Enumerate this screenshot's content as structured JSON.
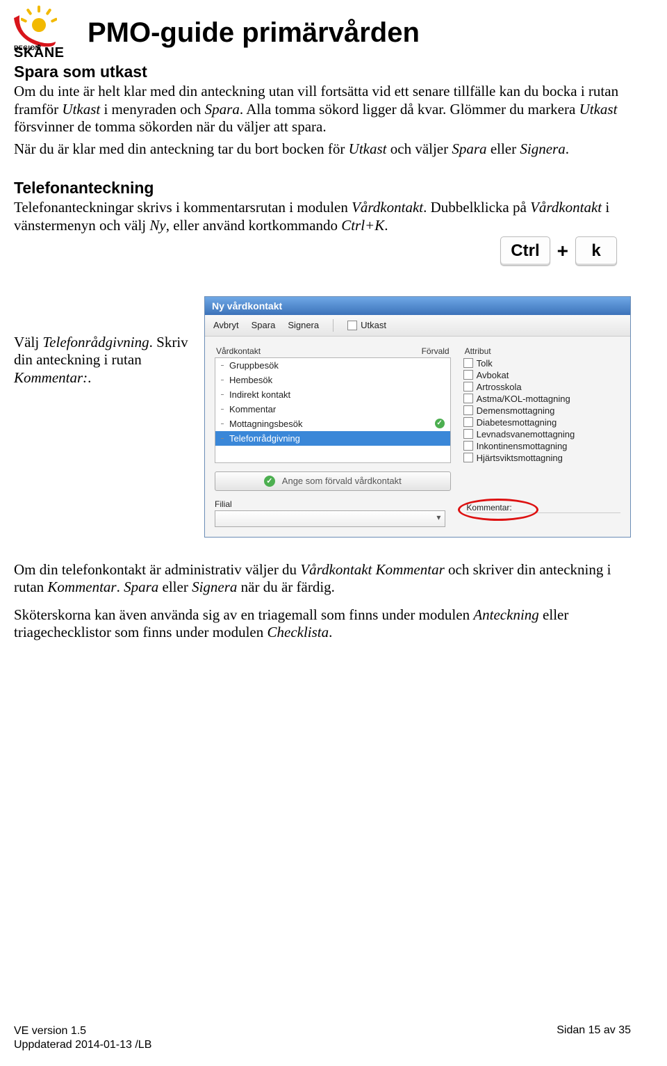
{
  "logo": {
    "region": "REGION",
    "skane": "SKÅNE"
  },
  "doc_title": "PMO-guide primärvården",
  "section1": {
    "heading": "Spara som utkast",
    "para1_a": "Om du inte är helt klar med din anteckning utan vill fortsätta vid ett senare tillfälle kan du bocka i rutan framför ",
    "para1_b": "Utkast",
    "para1_c": " i menyraden och ",
    "para1_d": "Spara",
    "para1_e": ". Alla tomma sökord ligger då kvar. Glömmer du markera ",
    "para1_f": "Utkast",
    "para1_g": " försvinner de tomma sökorden när du väljer att spara.",
    "para2_a": "När du är klar med din anteckning tar du bort bocken för ",
    "para2_b": "Utkast",
    "para2_c": " och väljer ",
    "para2_d": "Spara",
    "para2_e": " eller ",
    "para2_f": "Signera",
    "para2_g": "."
  },
  "section2": {
    "heading": "Telefonanteckning",
    "para_a": "Telefonanteckningar skrivs i kommentarsrutan i modulen ",
    "para_b": "Vårdkontakt",
    "para_c": ". Dubbelklicka på ",
    "para_d": "Vårdkontakt",
    "para_e": " i vänstermenyn och välj ",
    "para_f": "Ny",
    "para_g": ", eller använd kortkommando ",
    "para_h": "Ctrl+K",
    "para_i": "."
  },
  "keys": {
    "ctrl": "Ctrl",
    "plus": "+",
    "k": "k"
  },
  "fig_caption": {
    "a": "Välj ",
    "b": "Telefonrådgivning",
    "c": ". Skriv din anteckning i rutan ",
    "d": "Kommentar:",
    "e": "."
  },
  "dialog": {
    "title": "Ny vårdkontakt",
    "toolbar": {
      "avbryt": "Avbryt",
      "spara": "Spara",
      "signera": "Signera",
      "utkast": "Utkast"
    },
    "col_left_head": "Vårdkontakt",
    "col_left_head2": "Förvald",
    "col_right_head": "Attribut",
    "list": [
      "Gruppbesök",
      "Hembesök",
      "Indirekt kontakt",
      "Kommentar",
      "Mottagningsbesök",
      "Telefonrådgivning"
    ],
    "list_checked_index": 4,
    "list_selected_index": 5,
    "attrs": [
      "Tolk",
      "Avbokat",
      "Artrosskola",
      "Astma/KOL-mottagning",
      "Demensmottagning",
      "Diabetesmottagning",
      "Levnadsvanemottagning",
      "Inkontinensmottagning",
      "Hjärtsviktsmottagning"
    ],
    "forvald_btn": "Ange som förvald vårdkontakt",
    "filial_label": "Filial",
    "kommentar_label": "Kommentar:"
  },
  "after1": {
    "a": "Om din telefonkontakt är administrativ väljer du ",
    "b": "Vårdkontakt Kommentar",
    "c": " och skriver din anteckning i rutan ",
    "d": "Kommentar",
    "e": ". ",
    "f": "Spara",
    "g": " eller ",
    "h": "Signera",
    "i": " när du är färdig."
  },
  "after2": {
    "a": "Sköterskorna kan även använda sig av en triagemall som finns under modulen ",
    "b": "Anteckning",
    "c": " eller triagechecklistor som finns under modulen ",
    "d": "Checklista",
    "e": "."
  },
  "footer": {
    "version": "VE version 1.5",
    "updated": "Uppdaterad 2014-01-13 /LB",
    "page": "Sidan 15 av 35"
  }
}
